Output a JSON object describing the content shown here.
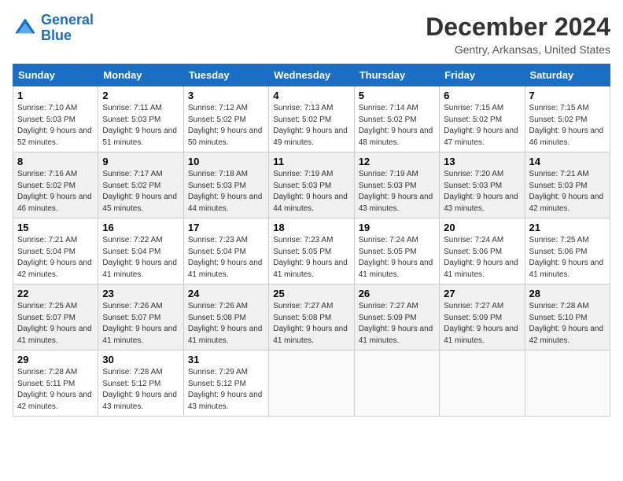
{
  "header": {
    "logo_line1": "General",
    "logo_line2": "Blue",
    "month": "December 2024",
    "location": "Gentry, Arkansas, United States"
  },
  "weekdays": [
    "Sunday",
    "Monday",
    "Tuesday",
    "Wednesday",
    "Thursday",
    "Friday",
    "Saturday"
  ],
  "weeks": [
    [
      {
        "day": "1",
        "sunrise": "7:10 AM",
        "sunset": "5:03 PM",
        "daylight": "9 hours and 52 minutes."
      },
      {
        "day": "2",
        "sunrise": "7:11 AM",
        "sunset": "5:03 PM",
        "daylight": "9 hours and 51 minutes."
      },
      {
        "day": "3",
        "sunrise": "7:12 AM",
        "sunset": "5:02 PM",
        "daylight": "9 hours and 50 minutes."
      },
      {
        "day": "4",
        "sunrise": "7:13 AM",
        "sunset": "5:02 PM",
        "daylight": "9 hours and 49 minutes."
      },
      {
        "day": "5",
        "sunrise": "7:14 AM",
        "sunset": "5:02 PM",
        "daylight": "9 hours and 48 minutes."
      },
      {
        "day": "6",
        "sunrise": "7:15 AM",
        "sunset": "5:02 PM",
        "daylight": "9 hours and 47 minutes."
      },
      {
        "day": "7",
        "sunrise": "7:15 AM",
        "sunset": "5:02 PM",
        "daylight": "9 hours and 46 minutes."
      }
    ],
    [
      {
        "day": "8",
        "sunrise": "7:16 AM",
        "sunset": "5:02 PM",
        "daylight": "9 hours and 46 minutes."
      },
      {
        "day": "9",
        "sunrise": "7:17 AM",
        "sunset": "5:02 PM",
        "daylight": "9 hours and 45 minutes."
      },
      {
        "day": "10",
        "sunrise": "7:18 AM",
        "sunset": "5:03 PM",
        "daylight": "9 hours and 44 minutes."
      },
      {
        "day": "11",
        "sunrise": "7:19 AM",
        "sunset": "5:03 PM",
        "daylight": "9 hours and 44 minutes."
      },
      {
        "day": "12",
        "sunrise": "7:19 AM",
        "sunset": "5:03 PM",
        "daylight": "9 hours and 43 minutes."
      },
      {
        "day": "13",
        "sunrise": "7:20 AM",
        "sunset": "5:03 PM",
        "daylight": "9 hours and 43 minutes."
      },
      {
        "day": "14",
        "sunrise": "7:21 AM",
        "sunset": "5:03 PM",
        "daylight": "9 hours and 42 minutes."
      }
    ],
    [
      {
        "day": "15",
        "sunrise": "7:21 AM",
        "sunset": "5:04 PM",
        "daylight": "9 hours and 42 minutes."
      },
      {
        "day": "16",
        "sunrise": "7:22 AM",
        "sunset": "5:04 PM",
        "daylight": "9 hours and 41 minutes."
      },
      {
        "day": "17",
        "sunrise": "7:23 AM",
        "sunset": "5:04 PM",
        "daylight": "9 hours and 41 minutes."
      },
      {
        "day": "18",
        "sunrise": "7:23 AM",
        "sunset": "5:05 PM",
        "daylight": "9 hours and 41 minutes."
      },
      {
        "day": "19",
        "sunrise": "7:24 AM",
        "sunset": "5:05 PM",
        "daylight": "9 hours and 41 minutes."
      },
      {
        "day": "20",
        "sunrise": "7:24 AM",
        "sunset": "5:06 PM",
        "daylight": "9 hours and 41 minutes."
      },
      {
        "day": "21",
        "sunrise": "7:25 AM",
        "sunset": "5:06 PM",
        "daylight": "9 hours and 41 minutes."
      }
    ],
    [
      {
        "day": "22",
        "sunrise": "7:25 AM",
        "sunset": "5:07 PM",
        "daylight": "9 hours and 41 minutes."
      },
      {
        "day": "23",
        "sunrise": "7:26 AM",
        "sunset": "5:07 PM",
        "daylight": "9 hours and 41 minutes."
      },
      {
        "day": "24",
        "sunrise": "7:26 AM",
        "sunset": "5:08 PM",
        "daylight": "9 hours and 41 minutes."
      },
      {
        "day": "25",
        "sunrise": "7:27 AM",
        "sunset": "5:08 PM",
        "daylight": "9 hours and 41 minutes."
      },
      {
        "day": "26",
        "sunrise": "7:27 AM",
        "sunset": "5:09 PM",
        "daylight": "9 hours and 41 minutes."
      },
      {
        "day": "27",
        "sunrise": "7:27 AM",
        "sunset": "5:09 PM",
        "daylight": "9 hours and 41 minutes."
      },
      {
        "day": "28",
        "sunrise": "7:28 AM",
        "sunset": "5:10 PM",
        "daylight": "9 hours and 42 minutes."
      }
    ],
    [
      {
        "day": "29",
        "sunrise": "7:28 AM",
        "sunset": "5:11 PM",
        "daylight": "9 hours and 42 minutes."
      },
      {
        "day": "30",
        "sunrise": "7:28 AM",
        "sunset": "5:12 PM",
        "daylight": "9 hours and 43 minutes."
      },
      {
        "day": "31",
        "sunrise": "7:29 AM",
        "sunset": "5:12 PM",
        "daylight": "9 hours and 43 minutes."
      },
      null,
      null,
      null,
      null
    ]
  ]
}
